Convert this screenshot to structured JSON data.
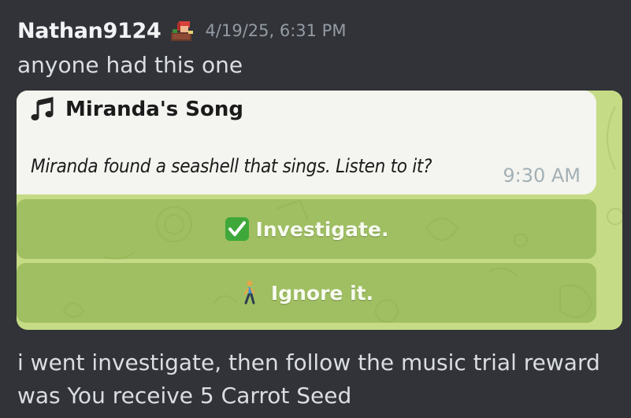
{
  "message": {
    "author": "Nathan9124",
    "author_badge_icon": "pixel-character-badge-icon",
    "timestamp": "4/19/25, 6:31 PM",
    "text_top": "anyone had this one",
    "text_bottom": "i went investigate, then follow the music trial  reward was You receive 5 Carrot Seed"
  },
  "screenshot": {
    "chat_background": "#c9dd8a",
    "bubble": {
      "title_icon": "musical-notes-icon",
      "title": "Miranda's Song",
      "body": "Miranda found a seashell that sings. Listen to it?",
      "time": "9:30 AM"
    },
    "buttons": [
      {
        "icon": "check-mark-button-icon",
        "label": "Investigate."
      },
      {
        "icon": "person-walking-icon",
        "label": "Ignore it."
      }
    ]
  },
  "colors": {
    "background": "#313338",
    "username": "#f2f3f5",
    "timestamp": "#949ba4",
    "message_text": "#dbdee1",
    "button_fill": "#80a846",
    "check_green": "#3fa83a"
  }
}
